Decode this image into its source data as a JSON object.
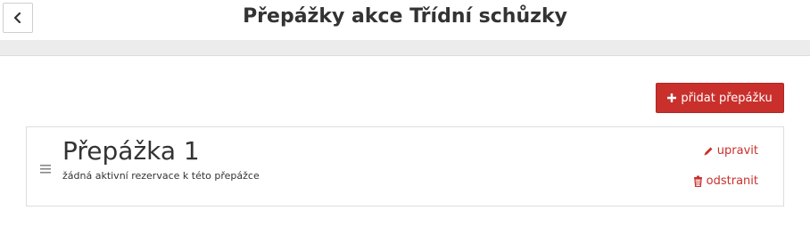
{
  "header": {
    "title": "Přepážky akce Třídní schůzky",
    "back_icon": "chevron-left-icon"
  },
  "toolbar": {
    "add_label": "přidat přepážku",
    "add_icon": "plus-icon"
  },
  "counters": [
    {
      "title": "Přepážka 1",
      "subtitle": "žádná aktivní rezervace k této přepážce",
      "edit_label": "upravit",
      "delete_label": "odstranit"
    }
  ],
  "colors": {
    "accent": "#c9302c",
    "strip": "#ececec"
  }
}
